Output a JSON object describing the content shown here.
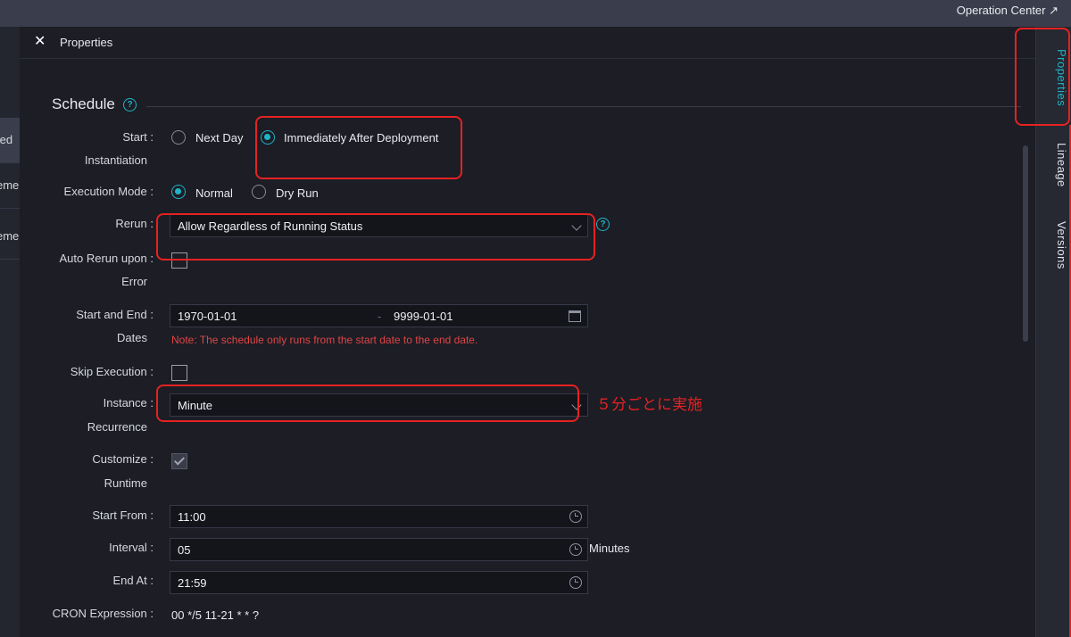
{
  "topbar": {
    "operation_center": "Operation Center ↗"
  },
  "left_strip": {
    "items": [
      "ted",
      "eme",
      "eme"
    ]
  },
  "panel": {
    "title": "Properties",
    "close_icon": "close-icon"
  },
  "schedule": {
    "title": "Schedule",
    "start_instantiation": {
      "label_line1": "Start :",
      "label_line2": "Instantiation",
      "options": [
        "Next Day",
        "Immediately After Deployment"
      ],
      "selected": "Immediately After Deployment"
    },
    "execution_mode": {
      "label": "Execution Mode :",
      "options": [
        "Normal",
        "Dry Run"
      ],
      "selected": "Normal"
    },
    "rerun": {
      "label": "Rerun :",
      "value": "Allow Regardless of Running Status"
    },
    "auto_rerun": {
      "label_line1": "Auto Rerun upon :",
      "label_line2": "Error",
      "checked": false
    },
    "dates": {
      "label_line1": "Start and End :",
      "label_line2": "Dates",
      "start": "1970-01-01",
      "separator": "-",
      "end": "9999-01-01",
      "note": "Note: The schedule only runs from the start date to the end date."
    },
    "skip_execution": {
      "label": "Skip Execution :",
      "checked": false
    },
    "instance_recurrence": {
      "label_line1": "Instance :",
      "label_line2": "Recurrence",
      "value": "Minute"
    },
    "customize_runtime": {
      "label_line1": "Customize :",
      "label_line2": "Runtime",
      "checked": true
    },
    "start_from": {
      "label": "Start From :",
      "value": "11:00"
    },
    "interval": {
      "label": "Interval :",
      "value": "05",
      "unit": "Minutes"
    },
    "end_at": {
      "label": "End At :",
      "value": "21:59"
    },
    "cron": {
      "label": "CRON Expression :",
      "value": "00 */5 11-21 * * ?"
    }
  },
  "annotation": {
    "note_jp": "５分ごとに実施",
    "highlight_color": "#e52222"
  },
  "right_tabs": [
    "Properties",
    "Lineage",
    "Versions"
  ],
  "colors": {
    "accent": "#1fb5c6",
    "note_red": "#e04545"
  }
}
